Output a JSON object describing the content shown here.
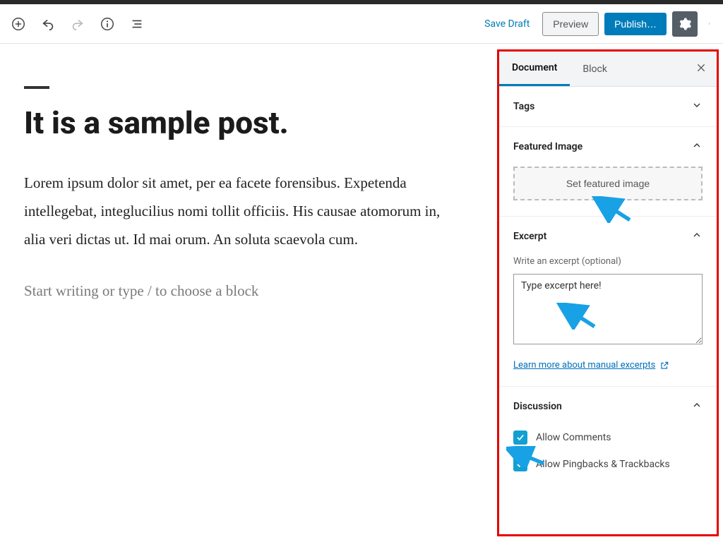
{
  "toolbar": {
    "save_draft": "Save Draft",
    "preview": "Preview",
    "publish": "Publish…"
  },
  "editor": {
    "title": "It is a sample post.",
    "body": "Lorem ipsum dolor sit amet, per ea facete forensibus. Expetenda intellegebat, integlucilius nomi tollit officiis. His causae atomorum in, alia veri dictas ut. Id mai orum. An soluta scaevola cum.",
    "placeholder": "Start writing or type / to choose a block"
  },
  "sidebar": {
    "tabs": {
      "document": "Document",
      "block": "Block"
    },
    "panels": {
      "tags": {
        "title": "Tags"
      },
      "featured_image": {
        "title": "Featured Image",
        "button": "Set featured image"
      },
      "excerpt": {
        "title": "Excerpt",
        "label": "Write an excerpt (optional)",
        "value": "Type excerpt here!",
        "learn_more": "Learn more about manual excerpts"
      },
      "discussion": {
        "title": "Discussion",
        "allow_comments": "Allow Comments",
        "allow_pingbacks": "Allow Pingbacks & Trackbacks"
      }
    }
  },
  "colors": {
    "accent": "#007cba",
    "highlight_border": "#e60000",
    "arrow": "#19a1e6"
  }
}
